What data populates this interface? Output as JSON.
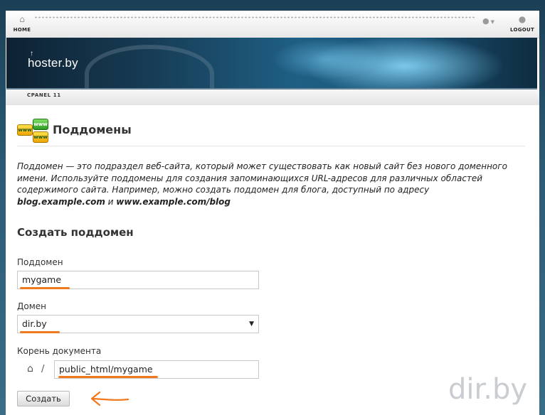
{
  "topbar": {
    "home_label": "HOME",
    "logout_label": "LOGOUT",
    "home_icon": "home-icon",
    "user_icon": "user-icon",
    "logout_icon": "logout-icon"
  },
  "banner": {
    "logo_text": "hoster.by",
    "cpanel_label": "CPANEL 11"
  },
  "page": {
    "title": "Поддомены",
    "title_icon": "www-icon",
    "description_parts": {
      "text": "Поддомен — это подраздел веб-сайта, который может существовать как новый сайт без нового доменного имени. Используйте поддомены для создания запоминающихся URL-адресов для различных областей содержимого сайта. Например, можно создать поддомен для блога, доступный по адресу ",
      "example1": "blog.example.com",
      "conj": " и ",
      "example2": "www.example.com/blog"
    }
  },
  "form": {
    "title": "Создать поддомен",
    "subdomain_label": "Поддомен",
    "subdomain_value": "mygame",
    "domain_label": "Домен",
    "domain_value": "dir.by",
    "docroot_label": "Корень документа",
    "docroot_prefix": "/",
    "docroot_value": "public_html/mygame",
    "submit_label": "Создать"
  },
  "watermark": "dir.by",
  "colors": {
    "annotation": "#f2781e",
    "frame_bg": "#2b5a74"
  }
}
